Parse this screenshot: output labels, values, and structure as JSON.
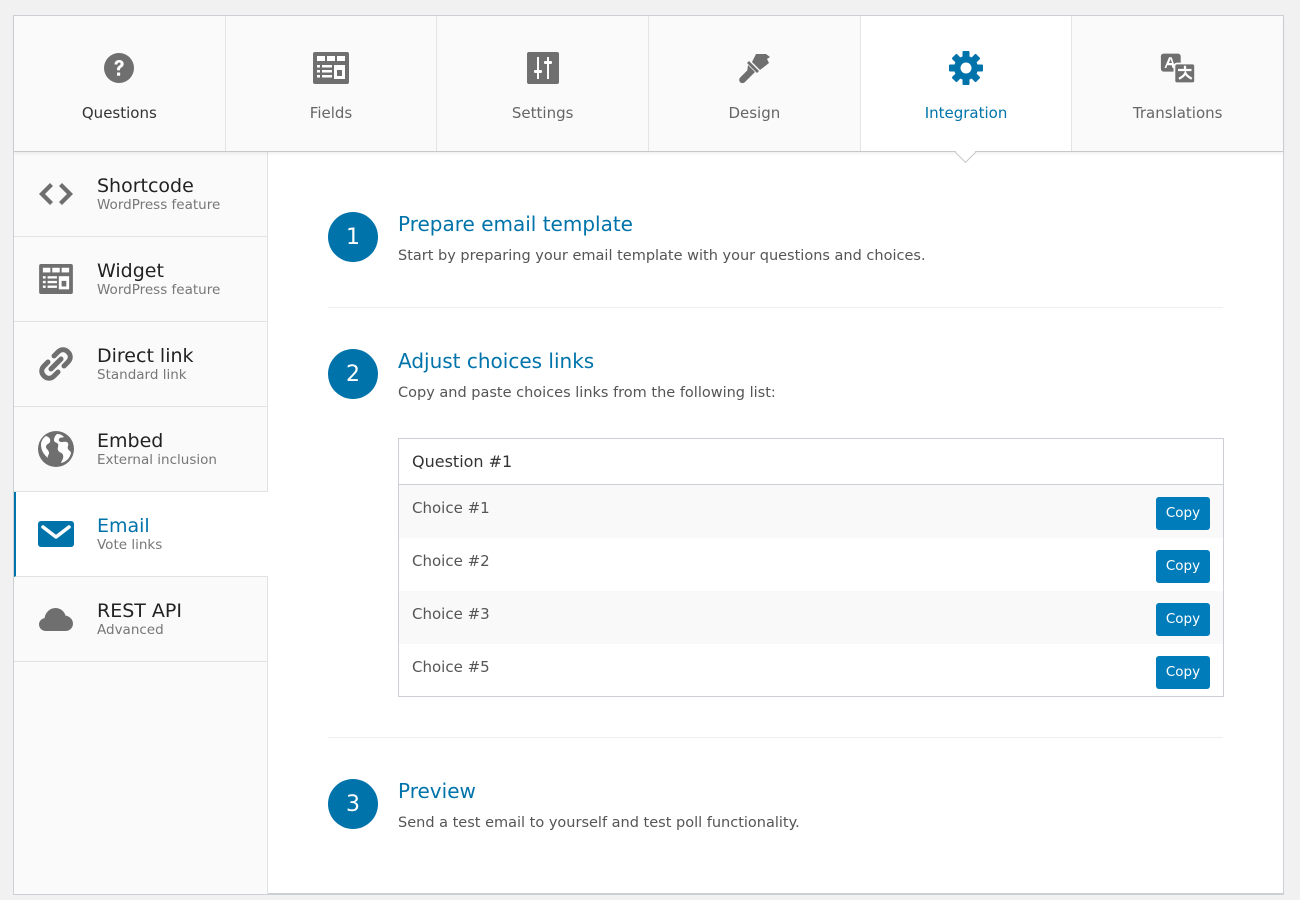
{
  "colors": {
    "accent": "#0073aa",
    "button": "#007cba",
    "icon_gray": "#6f6f6f"
  },
  "tabs": [
    {
      "label": "Questions",
      "icon": "question-circle-icon"
    },
    {
      "label": "Fields",
      "icon": "form-fields-icon"
    },
    {
      "label": "Settings",
      "icon": "sliders-icon"
    },
    {
      "label": "Design",
      "icon": "paintbrush-icon"
    },
    {
      "label": "Integration",
      "icon": "gear-icon",
      "active": true
    },
    {
      "label": "Translations",
      "icon": "translate-icon"
    }
  ],
  "sidebar": {
    "items": [
      {
        "title": "Shortcode",
        "subtitle": "WordPress feature",
        "icon": "code-brackets-icon"
      },
      {
        "title": "Widget",
        "subtitle": "WordPress feature",
        "icon": "widget-icon"
      },
      {
        "title": "Direct link",
        "subtitle": "Standard link",
        "icon": "link-icon"
      },
      {
        "title": "Embed",
        "subtitle": "External inclusion",
        "icon": "globe-icon"
      },
      {
        "title": "Email",
        "subtitle": "Vote links",
        "icon": "envelope-icon",
        "active": true
      },
      {
        "title": "REST API",
        "subtitle": "Advanced",
        "icon": "cloud-icon"
      }
    ]
  },
  "steps": [
    {
      "number": "1",
      "title": "Prepare email template",
      "description": "Start by preparing your email template with your questions and choices."
    },
    {
      "number": "2",
      "title": "Adjust choices links",
      "description": "Copy and paste choices links from the following list:"
    },
    {
      "number": "3",
      "title": "Preview",
      "description": "Send a test email to yourself and test poll functionality."
    }
  ],
  "choices_table": {
    "question": "Question #1",
    "copy_label": "Copy",
    "choices": [
      "Choice #1",
      "Choice #2",
      "Choice #3",
      "Choice #5"
    ]
  }
}
